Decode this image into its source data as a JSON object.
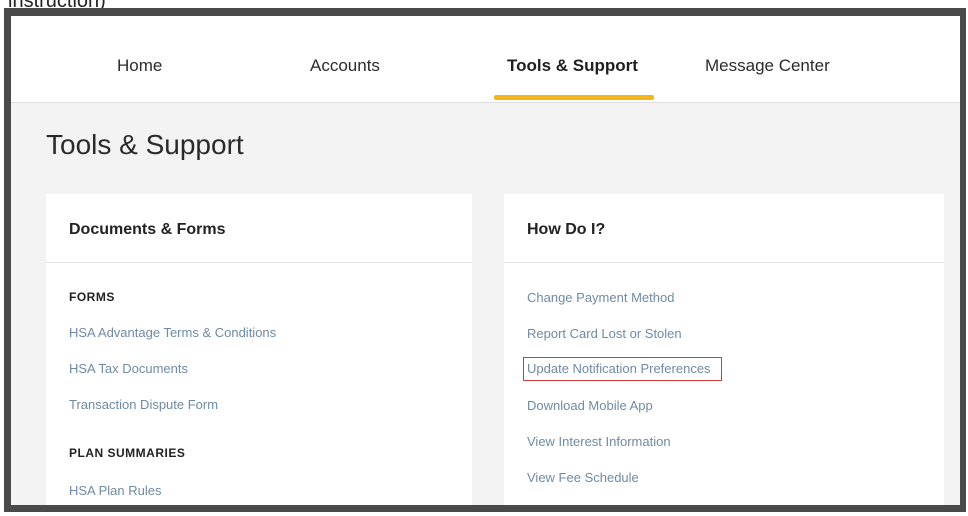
{
  "fragment_text": "instruction)",
  "nav": {
    "items": [
      {
        "label": "Home"
      },
      {
        "label": "Accounts"
      },
      {
        "label": "Tools & Support"
      },
      {
        "label": "Message Center"
      }
    ],
    "active": "Tools & Support",
    "accent_color": "#f5b41a"
  },
  "page": {
    "title": "Tools & Support"
  },
  "documents_card": {
    "title": "Documents & Forms",
    "forms_heading": "FORMS",
    "forms_links": [
      {
        "label": "HSA Advantage Terms & Conditions"
      },
      {
        "label": "HSA Tax Documents"
      },
      {
        "label": "Transaction Dispute Form"
      }
    ],
    "plan_heading": "PLAN SUMMARIES",
    "plan_links": [
      {
        "label": "HSA Plan Rules"
      }
    ]
  },
  "howdoi_card": {
    "title": "How Do I?",
    "links": [
      {
        "label": "Change Payment Method"
      },
      {
        "label": "Report Card Lost or Stolen"
      },
      {
        "label": "Update Notification Preferences",
        "highlighted": true
      },
      {
        "label": "Download Mobile App"
      },
      {
        "label": "View Interest Information"
      },
      {
        "label": "View Fee Schedule"
      }
    ],
    "highlight_color": "#d33a3a"
  }
}
